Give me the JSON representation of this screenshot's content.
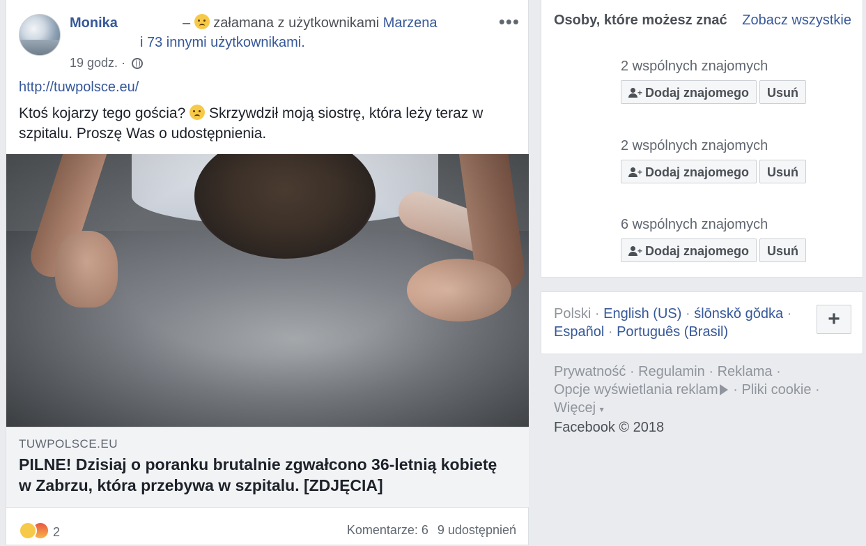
{
  "post": {
    "author": "Monika",
    "feeling_dash": "–",
    "feeling_text": "załamana z użytkownikami",
    "tagged_name": "Marzena",
    "tagged_others": "i 73 innymi użytkownikami.",
    "timestamp": "19 godz.",
    "timestamp_sep": "·",
    "more_label": "•••",
    "url": "http://tuwpolsce.eu/",
    "text_part1": "Ktoś kojarzy tego gościa?",
    "text_part2": "Skrzywdził moją siostrę, która leży teraz w szpitalu. Proszę Was o udostępnienia.",
    "link_domain": "TUWPOLSCE.EU",
    "link_title": "PILNE! Dzisiaj o poranku brutalnie zgwałcono 36-letnią kobietę w Zabrzu, która przebywa w szpitalu. [ZDJĘCIA]",
    "reaction_count": "2",
    "comments": "Komentarze: 6",
    "shares": "9 udostępnień",
    "icons": [
      "globe-icon",
      "sad-emoji-icon",
      "angry-reaction-icon",
      "more-icon"
    ]
  },
  "pymk": {
    "title": "Osoby, które możesz znać",
    "see_all": "Zobacz wszystkie",
    "suggestions": [
      {
        "mutual": "2 wspólnych znajomych",
        "add": "Dodaj znajomego",
        "remove": "Usuń"
      },
      {
        "mutual": "2 wspólnych znajomych",
        "add": "Dodaj znajomego",
        "remove": "Usuń"
      },
      {
        "mutual": "6 wspólnych znajomych",
        "add": "Dodaj znajomego",
        "remove": "Usuń"
      }
    ]
  },
  "languages": {
    "current": "Polski",
    "others": [
      "English (US)",
      "ślōnskŏ gŏdka",
      "Español",
      "Português (Brasil)"
    ],
    "sep": "·",
    "add_label": "+"
  },
  "footer": {
    "links": [
      "Prywatność",
      "Regulamin",
      "Reklama",
      "Opcje wyświetlania reklam",
      "Pliki cookie",
      "Więcej"
    ],
    "sep": "·",
    "copyright": "Facebook © 2018"
  }
}
